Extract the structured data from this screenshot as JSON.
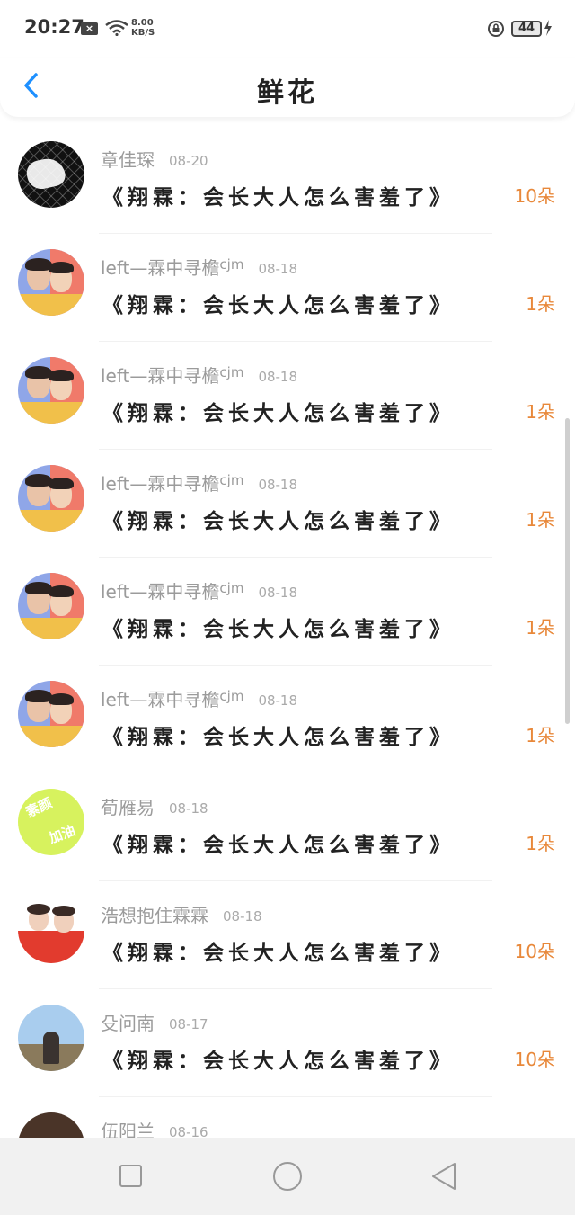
{
  "status_bar": {
    "time": "20:27",
    "net_speed_value": "8.00",
    "net_speed_unit": "KB/S",
    "battery": "44"
  },
  "header": {
    "title": "鲜花"
  },
  "colors": {
    "accent_blue": "#1e90ff",
    "count_orange": "#e8883a"
  },
  "entries": [
    {
      "user": "章佳琛",
      "user_sup": "",
      "date": "08-20",
      "book": "《翔霖：会长大人怎么害羞了》",
      "count": "10朵",
      "avatar": "hand-avatar"
    },
    {
      "user": "left—霖中寻檐",
      "user_sup": "cjm",
      "date": "08-18",
      "book": "《翔霖：会长大人怎么害羞了》",
      "count": "1朵",
      "avatar": "duo-avatar"
    },
    {
      "user": "left—霖中寻檐",
      "user_sup": "cjm",
      "date": "08-18",
      "book": "《翔霖：会长大人怎么害羞了》",
      "count": "1朵",
      "avatar": "duo-avatar"
    },
    {
      "user": "left—霖中寻檐",
      "user_sup": "cjm",
      "date": "08-18",
      "book": "《翔霖：会长大人怎么害羞了》",
      "count": "1朵",
      "avatar": "duo-avatar"
    },
    {
      "user": "left—霖中寻檐",
      "user_sup": "cjm",
      "date": "08-18",
      "book": "《翔霖：会长大人怎么害羞了》",
      "count": "1朵",
      "avatar": "duo-avatar"
    },
    {
      "user": "left—霖中寻檐",
      "user_sup": "cjm",
      "date": "08-18",
      "book": "《翔霖：会长大人怎么害羞了》",
      "count": "1朵",
      "avatar": "duo-avatar"
    },
    {
      "user": "荀雁易",
      "user_sup": "",
      "date": "08-18",
      "book": "《翔霖：会长大人怎么害羞了》",
      "count": "1朵",
      "avatar": "green-avatar"
    },
    {
      "user": "浩想抱住霖霖",
      "user_sup": "",
      "date": "08-18",
      "book": "《翔霖：会长大人怎么害羞了》",
      "count": "10朵",
      "avatar": "red-avatar"
    },
    {
      "user": "殳问南",
      "user_sup": "",
      "date": "08-17",
      "book": "《翔霖：会长大人怎么害羞了》",
      "count": "10朵",
      "avatar": "sky-avatar"
    },
    {
      "user": "伍阳兰",
      "user_sup": "",
      "date": "08-16",
      "book": "",
      "count": "",
      "avatar": "dark-avatar"
    }
  ],
  "green_avatar_text": [
    "素颜",
    "加油"
  ],
  "icons": {
    "back": "chevron-left-icon",
    "nav_recent": "square-icon",
    "nav_home": "circle-icon",
    "nav_back": "triangle-back-icon"
  }
}
